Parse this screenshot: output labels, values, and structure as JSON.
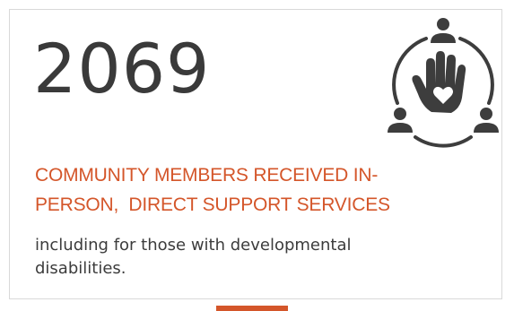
{
  "stat": {
    "number": "2069",
    "heading_line1": "COMMUNITY MEMBERS RECEIVED IN-",
    "heading_line2": "PERSON,  DIRECT SUPPORT SERVICES",
    "description_line1": "including for those with developmental",
    "description_line2": "disabilities.",
    "icon": "community-hand-heart-icon"
  },
  "colors": {
    "accent": "#d4562a",
    "text": "#3a3a3a",
    "icon": "#3d3d3d",
    "border": "#d9d9d9"
  }
}
